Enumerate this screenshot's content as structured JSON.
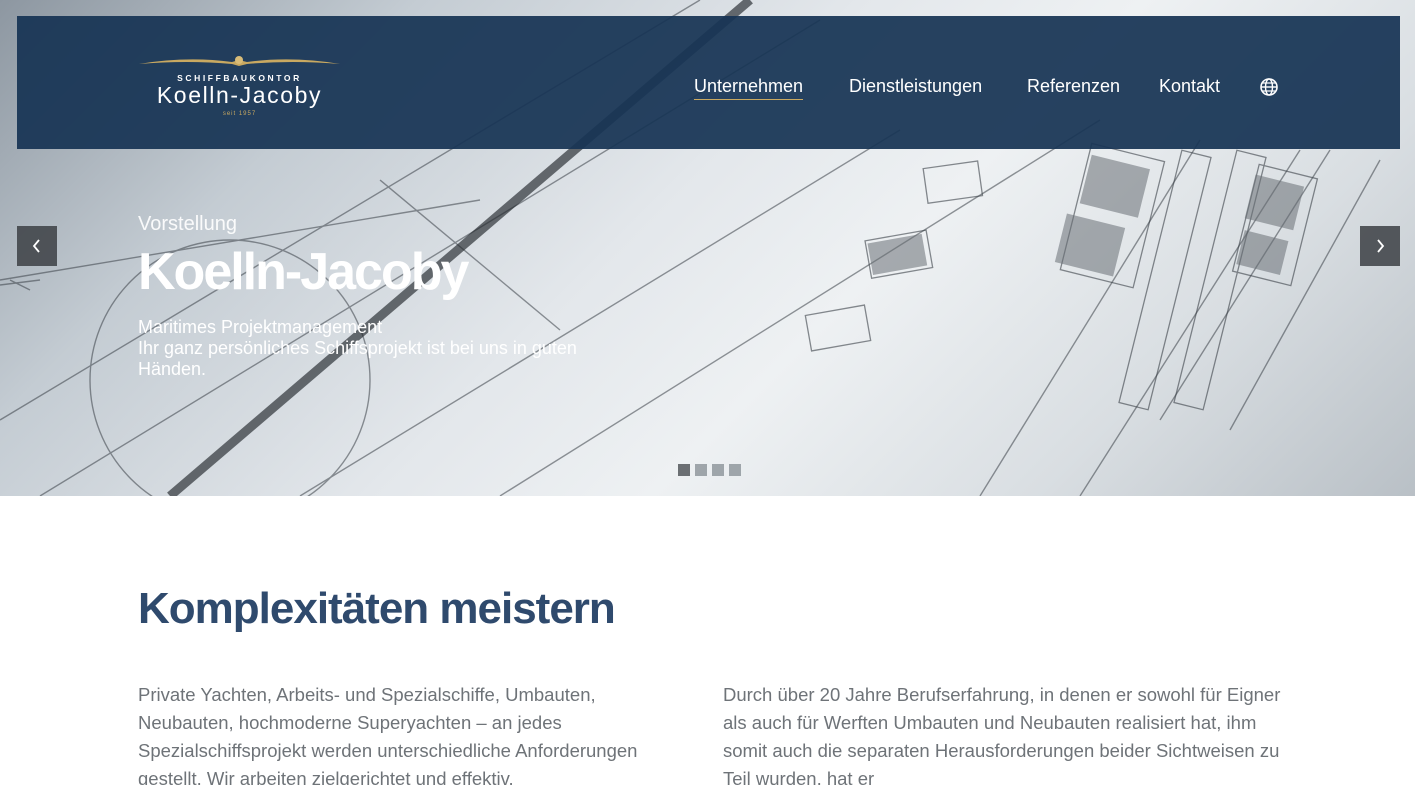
{
  "header": {
    "logo": {
      "subtitle": "SCHIFFBAUKONTOR",
      "name": "Koelln-Jacoby",
      "since": "seit 1957"
    },
    "nav": [
      {
        "label": "Unternehmen",
        "active": true
      },
      {
        "label": "Dienstleistungen",
        "active": false
      },
      {
        "label": "Referenzen",
        "active": false
      },
      {
        "label": "Kontakt",
        "active": false
      }
    ],
    "language_icon": "globe-icon"
  },
  "slider": {
    "kicker": "Vorstellung",
    "title": "Koelln-Jacoby",
    "lines": [
      "Maritimes Projektmanagement",
      "Ihr ganz persönliches Schiffsprojekt ist bei uns in guten Händen."
    ],
    "slide_count": 4,
    "active_slide": 1,
    "prev_icon": "chevron-left-icon",
    "next_icon": "chevron-right-icon"
  },
  "content": {
    "title": "Komplexitäten meistern",
    "left": "Private Yachten, Arbeits- und Spezialschiffe, Umbauten, Neubauten, hochmoderne Superyachten – an jedes Spezialschiffsprojekt werden unterschiedliche Anforderungen gestellt. Wir arbeiten zielgerichtet und effektiv.",
    "right": "Durch über 20 Jahre Berufserfahrung, in denen er sowohl für Eigner als auch für Werften Umbauten und Neubauten realisiert hat, ihm somit auch die separaten Herausforderungen beider Sichtweisen zu Teil wurden, hat er"
  },
  "colors": {
    "nav_bg": "#173454",
    "accent_gold": "#c9a961",
    "heading": "#2f4a6d",
    "body_text": "#6e7378"
  }
}
